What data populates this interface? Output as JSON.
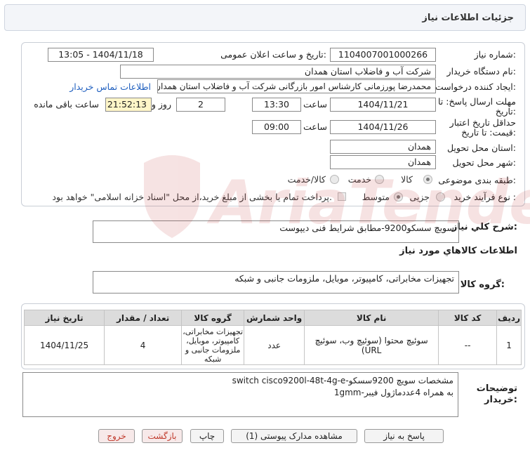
{
  "header": {
    "title": "جزئیات اطلاعات نیاز"
  },
  "form": {
    "need_number_label": "شماره نیاز:",
    "need_number": "1104007001000266",
    "announce_label": "تاریخ و ساعت اعلان عمومی:",
    "announce_value": "1404/11/18 - 13:05",
    "buyer_org_label": "نام دستگاه خریدار:",
    "buyer_org": "شرکت آب و فاضلاب استان همدان",
    "creator_label": "ایجاد کننده درخواست:",
    "creator": "محمدرضا پورزمانی کارشناس امور بازرگانی شرکت آب و فاضلاب استان همدان",
    "contact_link": "اطلاعات تماس خریدار",
    "reply_deadline_label": "مهلت ارسال پاسخ: تا",
    "reply_deadline_label2": "تاریخ:",
    "reply_date": "1404/11/21",
    "time_label": "ساعت",
    "reply_time": "13:30",
    "days_value": "2",
    "days_label": "روز و",
    "remaining_time": "21:52:13",
    "remaining_label": "ساعت باقی مانده",
    "validity_label": "حداقل تاریخ اعتبار",
    "validity_label2": "قیمت: تا تاریخ:",
    "validity_date": "1404/11/26",
    "validity_time": "09:00",
    "province_label": "استان محل تحویل:",
    "province": "همدان",
    "city_label": "شهر محل تحویل:",
    "city": "همدان",
    "category_label": "طبقه بندی موضوعی:",
    "category_options": [
      "کالا",
      "خدمت",
      "کالا/خدمت"
    ],
    "process_label": "نوع فرآیند خرید :",
    "process_options": [
      "جزیی",
      "متوسط"
    ],
    "payment_note": "پرداخت تمام یا بخشی از مبلغ خرید،از محل \"اسناد خزانه اسلامی\" خواهد بود."
  },
  "summary": {
    "label": "شرح کلي نياز:",
    "value": "سویچ سسکو9200-مطابق شرایط فنی دیپوست"
  },
  "goods_info_title": "اطلاعات كالاهاي مورد نياز",
  "goods_group": {
    "label": "گروه کالا:",
    "value": "تجهیزات مخابراتی، کامپیوتر، موبایل، ملزومات جانبی و شبکه"
  },
  "table": {
    "headers": [
      "ردیف",
      "کد کالا",
      "نام کالا",
      "واحد شمارش",
      "گروه کالا",
      "تعداد / مقدار",
      "تاریخ نیاز"
    ],
    "rows": [
      {
        "row": "1",
        "code": "--",
        "name": "سوئیچ محتوا (سوئیچ وب، سوئیچ URL)",
        "unit": "عدد",
        "group": "تجهیزات مخابراتی، کامپیوتر، موبایل، ملزومات جانبی و شبکه",
        "qty": "4",
        "date": "1404/11/25"
      }
    ]
  },
  "buyer_notes": {
    "label": "توضیحات",
    "label2": "خریدار:",
    "line1": "مشخصات سویچ 9200سسکو-switch cisco9200l-48t-4g-e",
    "line2": "به همراه 4عددماژول فیبر-1gmm"
  },
  "buttons": {
    "reply": "پاسخ به نیاز",
    "docs": "مشاهده مدارک پیوستی (1)",
    "print": "چاپ",
    "back": "بازگشت",
    "exit": "خروج"
  },
  "watermark": {
    "text": "AriaTender.net"
  },
  "colors": {
    "accent_link": "#1f5fbf",
    "remaining_bg": "#fff6c8",
    "watermark": "#c23a3a"
  }
}
